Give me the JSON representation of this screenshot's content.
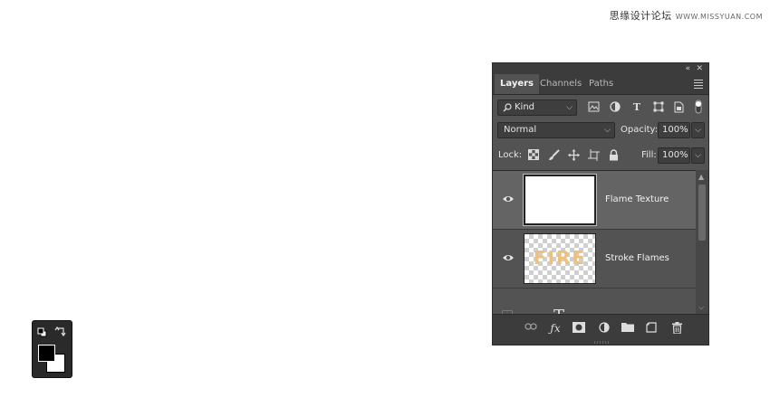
{
  "watermark": {
    "text": "思缘设计论坛",
    "site": "WWW.MISSYUAN.COM"
  },
  "panel": {
    "tabs": [
      {
        "label": "Layers",
        "active": true
      },
      {
        "label": "Channels",
        "active": false
      },
      {
        "label": "Paths",
        "active": false
      }
    ],
    "filter": {
      "label": "Kind"
    },
    "blend": {
      "mode": "Normal",
      "opacity_label": "Opacity:",
      "opacity": "100%"
    },
    "lock": {
      "label": "Lock:",
      "fill_label": "Fill:",
      "fill": "100%"
    },
    "layers": [
      {
        "name": "Flame Texture",
        "selected": true,
        "visible": true
      },
      {
        "name": "Stroke Flames",
        "selected": false,
        "visible": true,
        "thumb_text": "FIRE"
      },
      {
        "name": "",
        "type": "text",
        "glyph": "T"
      }
    ]
  },
  "colors": {
    "panel_bg": "#535353",
    "selected_row": "#646464",
    "dark_bar": "#3c3c3c"
  }
}
